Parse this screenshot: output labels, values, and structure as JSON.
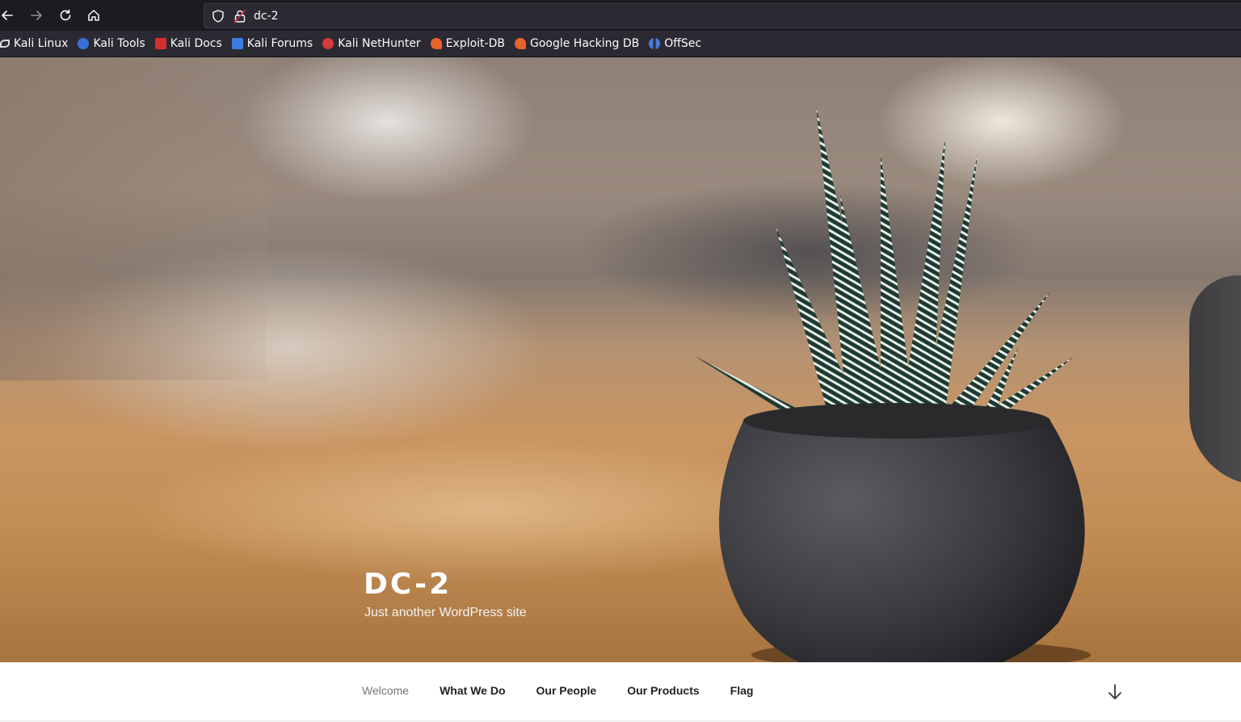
{
  "browser": {
    "url": "dc-2",
    "icons": {
      "back": "back-arrow-icon",
      "forward": "forward-arrow-icon",
      "reload": "reload-icon",
      "home": "home-icon",
      "shield": "shield-icon",
      "lock": "insecure-lock-icon"
    }
  },
  "bookmarks": [
    {
      "label": "Kali Linux",
      "icon": "kali-dragon-icon",
      "color": "#1a1a1a"
    },
    {
      "label": "Kali Tools",
      "icon": "kali-tools-icon",
      "color": "#3a6fd8"
    },
    {
      "label": "Kali Docs",
      "icon": "kali-docs-icon",
      "color": "#d62d2d"
    },
    {
      "label": "Kali Forums",
      "icon": "kali-forums-icon",
      "color": "#3a7ee0"
    },
    {
      "label": "Kali NetHunter",
      "icon": "nethunter-icon",
      "color": "#d43a3a"
    },
    {
      "label": "Exploit-DB",
      "icon": "exploit-db-icon",
      "color": "#e8622c"
    },
    {
      "label": "Google Hacking DB",
      "icon": "ghdb-icon",
      "color": "#e8622c"
    },
    {
      "label": "OffSec",
      "icon": "offsec-icon",
      "color": "#4a7bd8"
    }
  ],
  "site": {
    "title": "DC-2",
    "description": "Just another WordPress site"
  },
  "nav": {
    "items": [
      {
        "label": "Welcome",
        "current": true
      },
      {
        "label": "What We Do",
        "current": false
      },
      {
        "label": "Our People",
        "current": false
      },
      {
        "label": "Our Products",
        "current": false
      },
      {
        "label": "Flag",
        "current": false
      }
    ],
    "scroll_icon": "arrow-down-icon"
  }
}
